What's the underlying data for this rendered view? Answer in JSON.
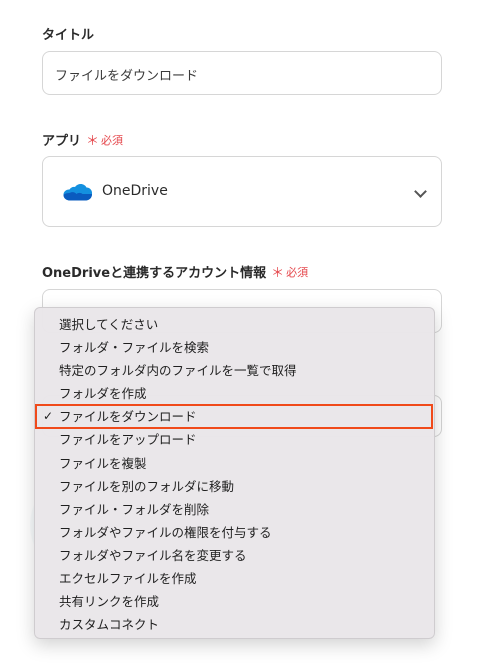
{
  "form": {
    "title_label": "タイトル",
    "title_value": "ファイルをダウンロード",
    "app_label": "アプリ",
    "required_mark": "＊",
    "required_text": "必須",
    "app_value": "OneDrive",
    "account_label": "OneDriveと連携するアカウント情報",
    "account_required_text": "必須"
  },
  "menu": {
    "check_glyph": "✓",
    "items": [
      "選択してください",
      "フォルダ・ファイルを検索",
      "特定のフォルダ内のファイルを一覧で取得",
      "フォルダを作成",
      "ファイルをダウンロード",
      "ファイルをアップロード",
      "ファイルを複製",
      "ファイルを別のフォルダに移動",
      "ファイル・フォルダを削除",
      "フォルダやファイルの権限を付与する",
      "フォルダやファイル名を変更する",
      "エクセルファイルを作成",
      "共有リンクを作成",
      "カスタムコネクト"
    ],
    "selected_index": 4
  },
  "colors": {
    "required": "#e5484d",
    "highlight": "#f04a1a",
    "onedrive": "#0f6cbd"
  }
}
